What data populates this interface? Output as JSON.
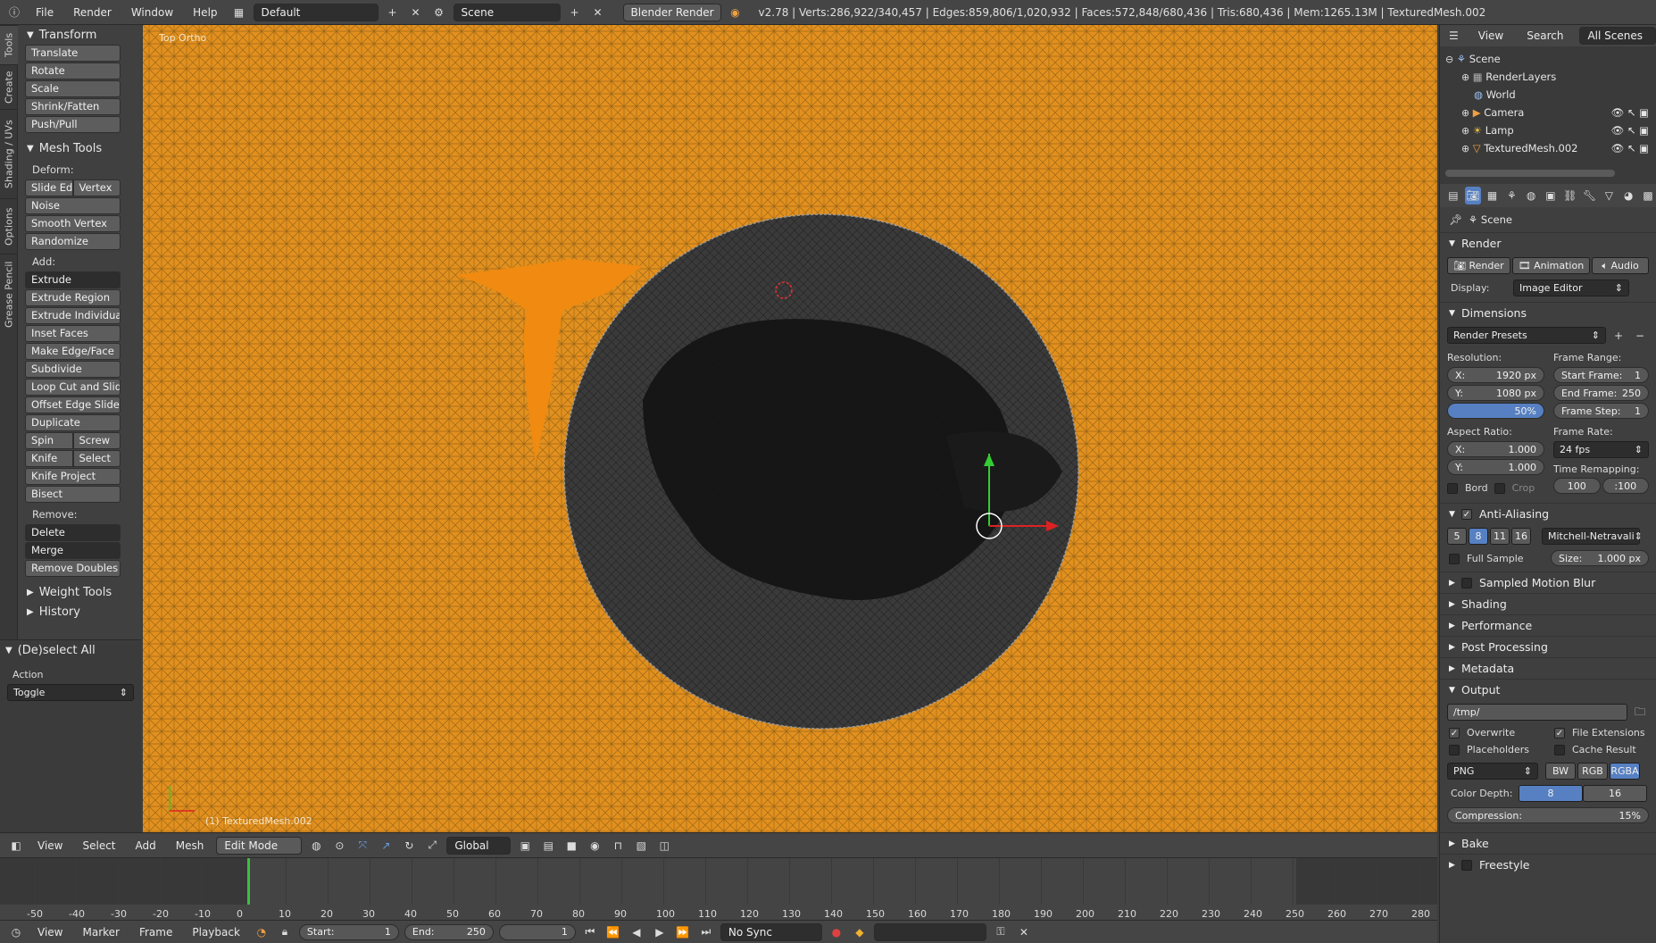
{
  "topbar": {
    "menus": [
      "File",
      "Render",
      "Window",
      "Help"
    ],
    "layout": "Default",
    "scene": "Scene",
    "engine": "Blender Render",
    "stats": "v2.78 | Verts:286,922/340,457 | Edges:859,806/1,020,932 | Faces:572,848/680,436 | Tris:680,436 | Mem:1265.13M | TexturedMesh.002"
  },
  "tool_tabs": [
    "Tools",
    "Create",
    "Shading / UVs",
    "Options",
    "Grease Pencil"
  ],
  "toolshelf": {
    "transform_title": "Transform",
    "transform": [
      "Translate",
      "Rotate",
      "Scale",
      "Shrink/Fatten",
      "Push/Pull"
    ],
    "mesh_tools_title": "Mesh Tools",
    "deform_label": "Deform:",
    "slide_edge": "Slide Ed",
    "vertex": "Vertex",
    "deform": [
      "Noise",
      "Smooth Vertex",
      "Randomize"
    ],
    "add_label": "Add:",
    "extrude": "Extrude",
    "add": [
      "Extrude Region",
      "Extrude Individual",
      "Inset Faces",
      "Make Edge/Face",
      "Subdivide",
      "Loop Cut and Slide",
      "Offset Edge Slide",
      "Duplicate"
    ],
    "spin": "Spin",
    "screw": "Screw",
    "knife": "Knife",
    "select": "Select",
    "knife_project": "Knife Project",
    "bisect": "Bisect",
    "remove_label": "Remove:",
    "delete": "Delete",
    "merge": "Merge",
    "remove_doubles": "Remove Doubles",
    "weight_tools": "Weight Tools",
    "history": "History"
  },
  "redo_panel": {
    "title": "(De)select All",
    "action_label": "Action",
    "action_value": "Toggle"
  },
  "viewport": {
    "view_name": "Top Ortho",
    "object_label": "(1) TexturedMesh.002"
  },
  "view3d_header": {
    "menus": [
      "View",
      "Select",
      "Add",
      "Mesh"
    ],
    "mode": "Edit Mode",
    "orientation": "Global"
  },
  "timeline": {
    "ticks": [
      "-50",
      "-40",
      "-30",
      "-20",
      "-10",
      "0",
      "10",
      "20",
      "30",
      "40",
      "50",
      "60",
      "70",
      "80",
      "90",
      "100",
      "110",
      "120",
      "130",
      "140",
      "150",
      "160",
      "170",
      "180",
      "190",
      "200",
      "210",
      "220",
      "230",
      "240",
      "250",
      "260",
      "270",
      "280"
    ],
    "current_frame": 0,
    "menus": [
      "View",
      "Marker",
      "Frame",
      "Playback"
    ],
    "start_label": "Start:",
    "start_value": "1",
    "end_label": "End:",
    "end_value": "250",
    "frame_value": "1",
    "sync": "No Sync"
  },
  "outliner": {
    "menus": [
      "View",
      "Search"
    ],
    "filter": "All Scenes",
    "items": [
      "Scene",
      "RenderLayers",
      "World",
      "Camera",
      "Lamp",
      "TexturedMesh.002"
    ]
  },
  "properties": {
    "context": "Scene",
    "render_section": "Render",
    "render_btn": "Render",
    "animation_btn": "Animation",
    "audio_btn": "Audio",
    "display_label": "Display:",
    "display_value": "Image Editor",
    "dimensions": "Dimensions",
    "render_presets": "Render Presets",
    "resolution_label": "Resolution:",
    "res_x_label": "X:",
    "res_x": "1920 px",
    "res_y_label": "Y:",
    "res_y": "1080 px",
    "res_pct": "50%",
    "frame_range_label": "Frame Range:",
    "start_frame_label": "Start Frame:",
    "start_frame": "1",
    "end_frame_label": "End Frame:",
    "end_frame": "250",
    "frame_step_label": "Frame Step:",
    "frame_step": "1",
    "aspect_label": "Aspect Ratio:",
    "aspect_x_label": "X:",
    "aspect_x": "1.000",
    "aspect_y_label": "Y:",
    "aspect_y": "1.000",
    "frame_rate_label": "Frame Rate:",
    "frame_rate": "24 fps",
    "time_remap_label": "Time Remapping:",
    "remap_old": "100",
    "remap_new": ":100",
    "bord": "Bord",
    "crop": "Crop",
    "anti_aliasing": "Anti-Aliasing",
    "aa_samples": [
      "5",
      "8",
      "11",
      "16"
    ],
    "aa_filter": "Mitchell-Netravali",
    "full_sample": "Full Sample",
    "size_label": "Size:",
    "size_value": "1.000 px",
    "sampled_motion_blur": "Sampled Motion Blur",
    "collapsed": [
      "Shading",
      "Performance",
      "Post Processing",
      "Metadata"
    ],
    "output": "Output",
    "output_path": "/tmp/",
    "overwrite": "Overwrite",
    "file_extensions": "File Extensions",
    "placeholders": "Placeholders",
    "cache_result": "Cache Result",
    "format": "PNG",
    "bw": "BW",
    "rgb": "RGB",
    "rgba": "RGBA",
    "color_depth_label": "Color Depth:",
    "depth_8": "8",
    "depth_16": "16",
    "compression_label": "Compression:",
    "compression_value": "15%",
    "bake": "Bake",
    "freestyle": "Freestyle"
  }
}
